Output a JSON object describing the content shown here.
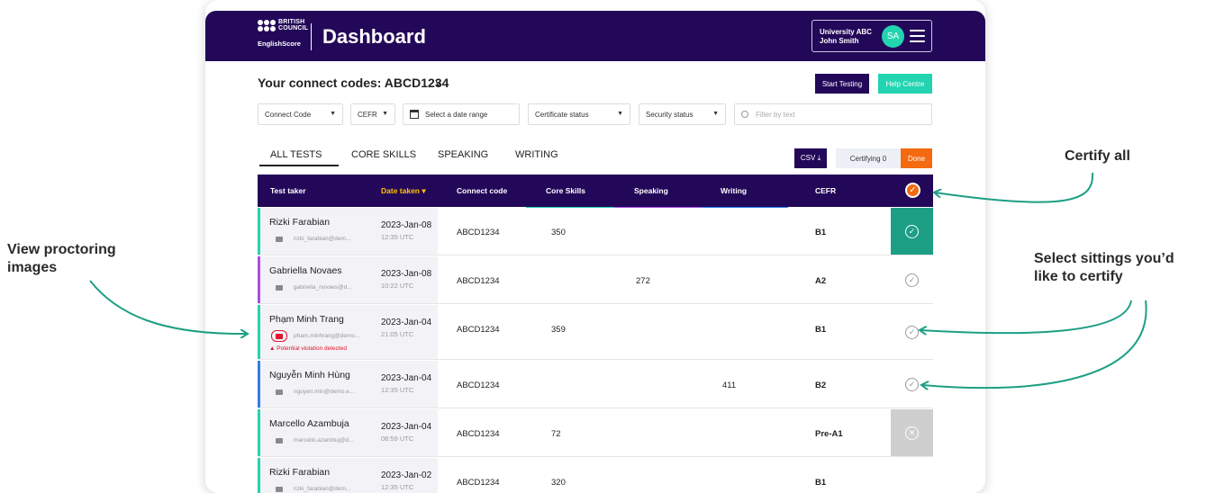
{
  "colors": {
    "brand": "#230859",
    "accent": "#23d4b0",
    "orange": "#f36a10",
    "certified": "#1d9f85",
    "violation": "#e0142c",
    "annotation": "#1d9f85"
  },
  "header": {
    "logo_line1": "BRITISH",
    "logo_line2": "COUNCIL",
    "logo_product": "EnglishScore",
    "title": "Dashboard",
    "org": "University ABC",
    "user": "John Smith",
    "avatar_initials": "SA",
    "menu_icon": "hamburger-icon"
  },
  "connect": {
    "title": "Your connect codes: ABCD1234",
    "chevron": "∨"
  },
  "actions": {
    "start_testing": "Start Testing",
    "help_centre": "Help Centre"
  },
  "filters": {
    "connect_code": "Connect Code",
    "cefr": "CEFR",
    "date_range": "Select a date range",
    "certificate_status": "Certificate status",
    "security_status": "Security status",
    "search_placeholder": "Filter by text"
  },
  "tabs": [
    "ALL TESTS",
    "CORE SKILLS",
    "SPEAKING",
    "WRITING"
  ],
  "toolbar": {
    "csv": "CSV ⤓",
    "certifying": "Certifying 0",
    "done": "Done"
  },
  "table": {
    "headers": [
      "Test taker",
      "Date taken ▾",
      "Connect code",
      "Core Skills",
      "Speaking",
      "Writing",
      "CEFR"
    ],
    "skill_colors": {
      "core": "#23d4b0",
      "speaking": "#a94fe0",
      "writing": "#2f7ee8"
    },
    "rows": [
      {
        "name": "Rizki Farabian",
        "email": "rizki_farabian@dem...",
        "date": "2023-Jan-08",
        "time": "12:35 UTC",
        "code": "ABCD1234",
        "core": "350",
        "speaking": "",
        "writing": "",
        "cefr": "B1",
        "stripe": "#23d4b0",
        "cert": "on",
        "violation": ""
      },
      {
        "name": "Gabriella Novaes",
        "email": "gabriella_novaes@d...",
        "date": "2023-Jan-08",
        "time": "10:22 UTC",
        "code": "ABCD1234",
        "core": "",
        "speaking": "272",
        "writing": "",
        "cefr": "A2",
        "stripe": "#a94fe0",
        "cert": "available",
        "violation": ""
      },
      {
        "name": "Phạm Minh Trang",
        "email": "pham.minhrang@demo...",
        "date": "2023-Jan-04",
        "time": "21:05 UTC",
        "code": "ABCD1234",
        "core": "359",
        "speaking": "",
        "writing": "",
        "cefr": "B1",
        "stripe": "#23d4b0",
        "cert": "available",
        "violation": "Potential violation detected"
      },
      {
        "name": "Nguyễn Minh Hùng",
        "email": "nguyen.min@demo.e...",
        "date": "2023-Jan-04",
        "time": "12:35 UTC",
        "code": "ABCD1234",
        "core": "",
        "speaking": "",
        "writing": "411",
        "cefr": "B2",
        "stripe": "#2f7ee8",
        "cert": "available",
        "violation": ""
      },
      {
        "name": "Marcello Azambuja",
        "email": "marcello.azambuj@d...",
        "date": "2023-Jan-04",
        "time": "08:59 UTC",
        "code": "ABCD1234",
        "core": "72",
        "speaking": "",
        "writing": "",
        "cefr": "Pre-A1",
        "stripe": "#23d4b0",
        "cert": "off",
        "violation": ""
      },
      {
        "name": "Rizki Farabian",
        "email": "rizki_farabian@dem...",
        "date": "2023-Jan-02",
        "time": "12:35 UTC",
        "code": "ABCD1234",
        "core": "320",
        "speaking": "",
        "writing": "",
        "cefr": "B1",
        "stripe": "#23d4b0",
        "cert": "none",
        "violation": ""
      }
    ]
  },
  "annotations": {
    "certify_all": "Certify all",
    "view_images_1": "View proctoring",
    "view_images_2": "images",
    "select_1": "Select sittings you’d",
    "select_2": "like to certify"
  }
}
